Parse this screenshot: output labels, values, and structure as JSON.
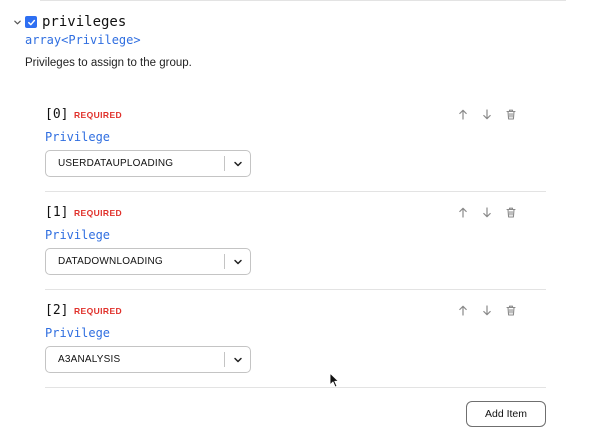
{
  "property": {
    "name": "privileges",
    "checked": true,
    "type": "array<Privilege>",
    "description": "Privileges to assign to the group."
  },
  "items": [
    {
      "index": "[0]",
      "required": "REQUIRED",
      "type": "Privilege",
      "value": "USERDATAUPLOADING"
    },
    {
      "index": "[1]",
      "required": "REQUIRED",
      "type": "Privilege",
      "value": "DATADOWNLOADING"
    },
    {
      "index": "[2]",
      "required": "REQUIRED",
      "type": "Privilege",
      "value": "A3ANALYSIS"
    }
  ],
  "actions": {
    "add_item_label": "Add Item"
  },
  "icons": {
    "collapse": "chevron-down-icon",
    "checkbox": "check-icon",
    "move_up": "arrow-up-icon",
    "move_down": "arrow-down-icon",
    "delete": "trash-icon",
    "select": "chevron-down-icon"
  },
  "colors": {
    "accent": "#2e6ff2",
    "type_text": "#2f6ee0",
    "required": "#e0302a"
  }
}
